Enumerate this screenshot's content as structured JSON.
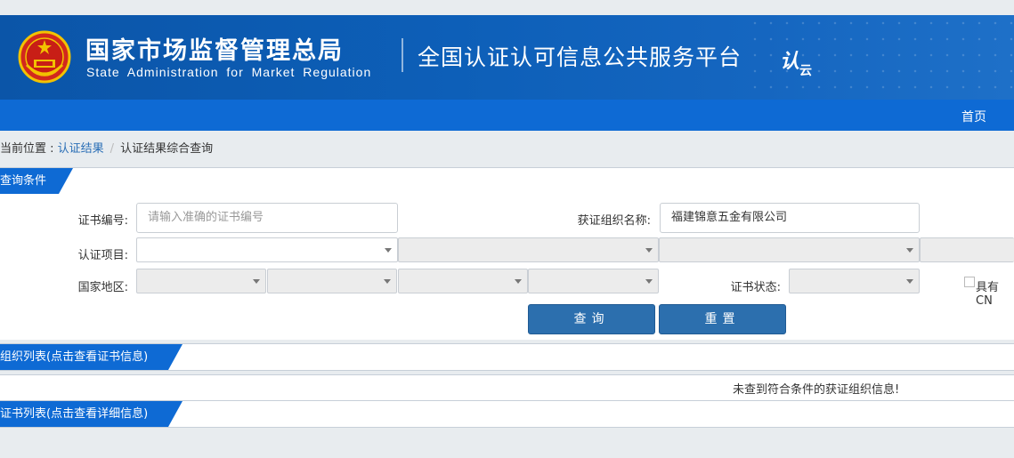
{
  "header": {
    "agency_cn": "国家市场监督管理总局",
    "agency_en": "State Administration  for  Market Regulation",
    "platform_title": "全国认证认可信息公共服务平台",
    "logo_mark": "认",
    "logo_sub": "云",
    "brand_color": "#0b55a8"
  },
  "nav": {
    "home": "首页",
    "bar_color": "#0e6ad4"
  },
  "breadcrumb": {
    "prefix": "当前位置 :",
    "link": "认证结果",
    "separator": "/",
    "current": "认证结果综合查询"
  },
  "query_panel": {
    "title": "查询条件",
    "cert_no_label": "证书编号:",
    "cert_no_placeholder": "请输入准确的证书编号",
    "org_name_label": "获证组织名称:",
    "org_name_value": "福建锦意五金有限公司",
    "cert_item_label": "认证项目:",
    "region_label": "国家地区:",
    "status_label": "证书状态:",
    "cnas_label": "具有CN",
    "query_button": "查询",
    "reset_button": "重置"
  },
  "org_list": {
    "title": "组织列表(点击查看证书信息)",
    "empty_message": "未查到符合条件的获证组织信息!"
  },
  "cert_list": {
    "title": "证书列表(点击查看详细信息)"
  }
}
